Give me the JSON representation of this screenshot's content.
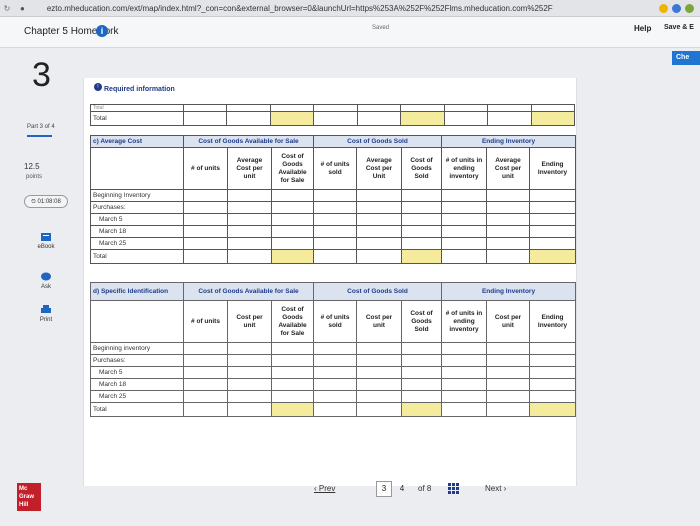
{
  "browser": {
    "url": "ezto.mheducation.com/ext/map/index.html?_con=con&external_browser=0&launchUrl=https%253A%252F%252Flms.mheducation.com%252F"
  },
  "header": {
    "title": "Chapter 5 Homework",
    "saved": "Saved",
    "help": "Help",
    "save_exit": "Save & E",
    "check": "Che"
  },
  "sidebar": {
    "question_number": "3",
    "part": "Part 3 of 4",
    "points_value": "12.5",
    "points_label": "points",
    "timer": "01:08:08",
    "tools": [
      {
        "label": "eBook",
        "icon": "ebook-icon"
      },
      {
        "label": "Ask",
        "icon": "ask-icon"
      },
      {
        "label": "Print",
        "icon": "print-icon"
      }
    ]
  },
  "required_info": "Required information",
  "top_total": {
    "cut": "Total",
    "label": "Total"
  },
  "table_c": {
    "tag": "c) Average Cost",
    "groups": [
      "Cost of Goods Available for Sale",
      "Cost of Goods Sold",
      "Ending Inventory"
    ],
    "cols": [
      "# of units",
      "Average Cost per unit",
      "Cost of Goods Available for Sale",
      "# of units sold",
      "Average Cost per Unit",
      "Cost of Goods Sold",
      "# of units in ending inventory",
      "Average Cost per unit",
      "Ending Inventory"
    ],
    "rows": [
      "Beginning Inventory",
      "Purchases:",
      "March 5",
      "March 18",
      "March 25",
      "Total"
    ]
  },
  "table_d": {
    "tag": "d) Specific Identification",
    "groups": [
      "Cost of Goods Available for Sale",
      "Cost of Goods Sold",
      "Ending Inventory"
    ],
    "cols": [
      "# of units",
      "Cost per unit",
      "Cost of Goods Available for Sale",
      "# of units sold",
      "Cost per unit",
      "Cost of Goods Sold",
      "# of units in ending inventory",
      "Cost per unit",
      "Ending Inventory"
    ],
    "rows": [
      "Beginning inventory",
      "Purchases:",
      "March 5",
      "March 18",
      "March 25",
      "Total"
    ]
  },
  "pager": {
    "prev": "Prev",
    "pages": [
      "3",
      "4"
    ],
    "of": "of 8",
    "next": "Next"
  },
  "logo": {
    "line1": "Mc",
    "line2": "Graw",
    "line3": "Hill"
  },
  "colors": {
    "accent": "#1f66c1",
    "header_fill": "#dbe3f0",
    "highlight": "#f4ec9c",
    "logo": "#c31f2b"
  }
}
